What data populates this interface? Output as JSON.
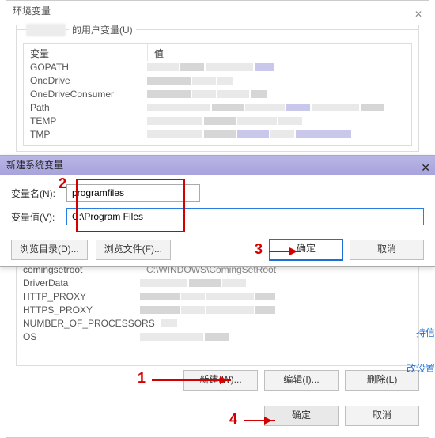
{
  "envwin": {
    "title": "环境变量",
    "user_section_label_suffix": "的用户变量(U)",
    "cols": {
      "name": "变量",
      "value": "值"
    },
    "user_vars": [
      "GOPATH",
      "OneDrive",
      "OneDriveConsumer",
      "Path",
      "TEMP",
      "TMP"
    ],
    "sys_vars": [
      "comingsetroot",
      "DriverData",
      "HTTP_PROXY",
      "HTTPS_PROXY",
      "NUMBER_OF_PROCESSORS",
      "OS"
    ],
    "sys_first_value": "C:\\WINDOWS\\ComingSetRoot",
    "btn_new": "新建(W)...",
    "btn_edit": "编辑(I)...",
    "btn_delete": "删除(L)",
    "btn_ok": "确定",
    "btn_cancel": "取消"
  },
  "dlg": {
    "title": "新建系统变量",
    "name_label": "变量名(N):",
    "value_label": "变量值(V):",
    "name_value": "programfiles",
    "value_value": "C:\\Program Files",
    "browse_dir": "浏览目录(D)...",
    "browse_file": "浏览文件(F)...",
    "ok": "确定",
    "cancel": "取消"
  },
  "annotations": {
    "n1": "1",
    "n2": "2",
    "n3": "3",
    "n4": "4"
  },
  "right_hints": {
    "a": "持信",
    "b": "改设置"
  },
  "colors": {
    "accent": "#1a6fd8",
    "annotation": "#d40000",
    "dlg_title_bg": "#a7a3dc"
  },
  "chart_data": null
}
